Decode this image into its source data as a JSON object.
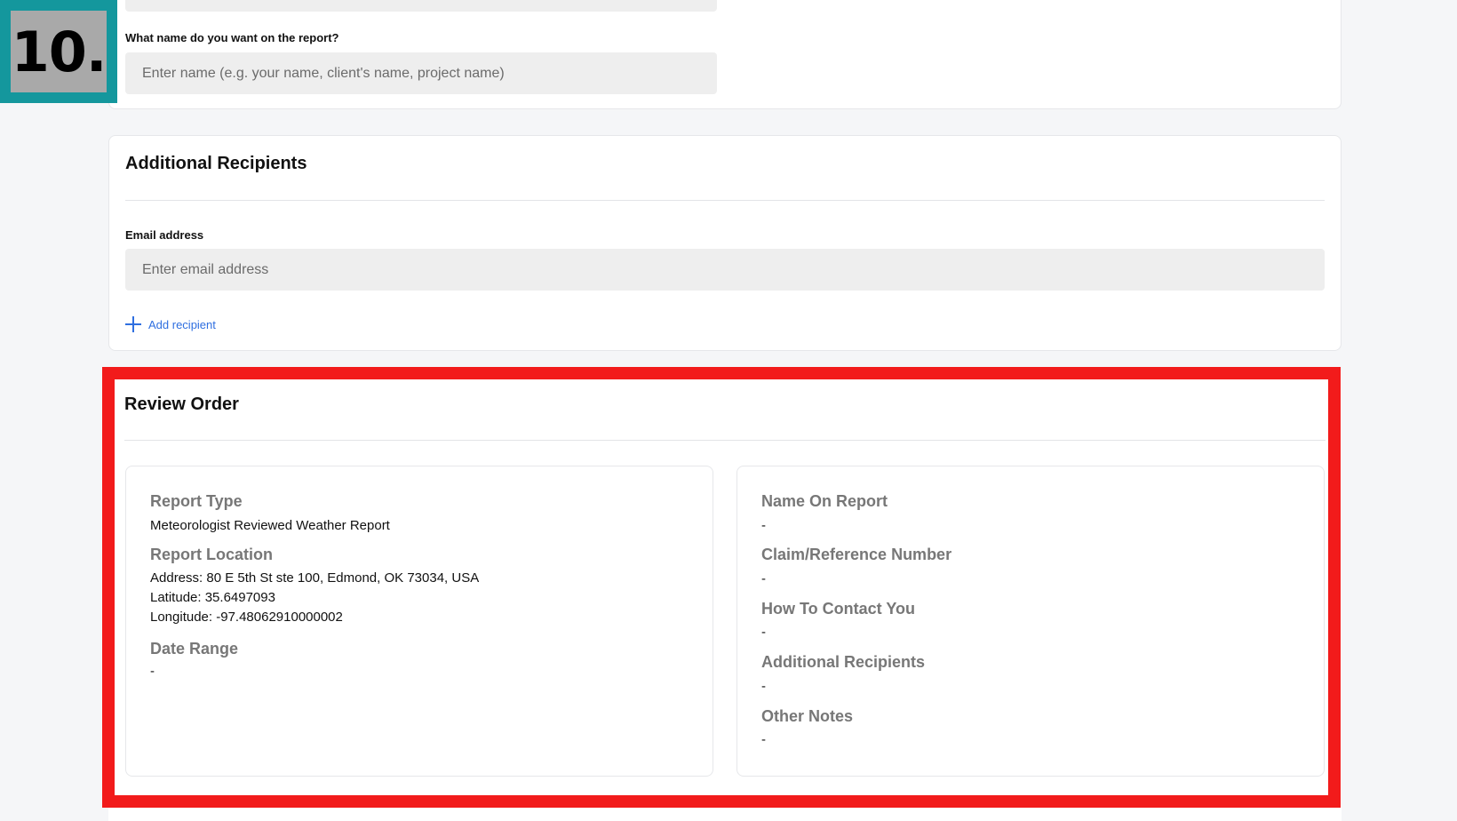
{
  "step_badge": {
    "text": "10."
  },
  "report_name": {
    "label": "What name do you want on the report?",
    "placeholder": "Enter name (e.g. your name, client's name, project name)"
  },
  "recipients": {
    "title": "Additional Recipients",
    "email_label": "Email address",
    "email_placeholder": "Enter email address",
    "add_label": "Add recipient"
  },
  "review": {
    "title": "Review Order",
    "left": {
      "report_type_heading": "Report Type",
      "report_type_value": "Meteorologist Reviewed Weather Report",
      "location_heading": "Report Location",
      "address": "Address: 80 E 5th St ste 100, Edmond, OK 73034, USA",
      "latitude": "Latitude: 35.6497093",
      "longitude": "Longitude: -97.48062910000002",
      "date_range_heading": "Date Range",
      "date_range_value": "-"
    },
    "right": {
      "name_heading": "Name On Report",
      "name_value": "-",
      "claim_heading": "Claim/Reference Number",
      "claim_value": "-",
      "contact_heading": "How To Contact You",
      "contact_value": "-",
      "recipients_heading": "Additional Recipients",
      "recipients_value": "-",
      "notes_heading": "Other Notes",
      "notes_value": "-"
    }
  },
  "colors": {
    "accent_link": "#2f6fe0",
    "highlight_frame": "#f21b1b",
    "badge_bg": "#14979d"
  }
}
